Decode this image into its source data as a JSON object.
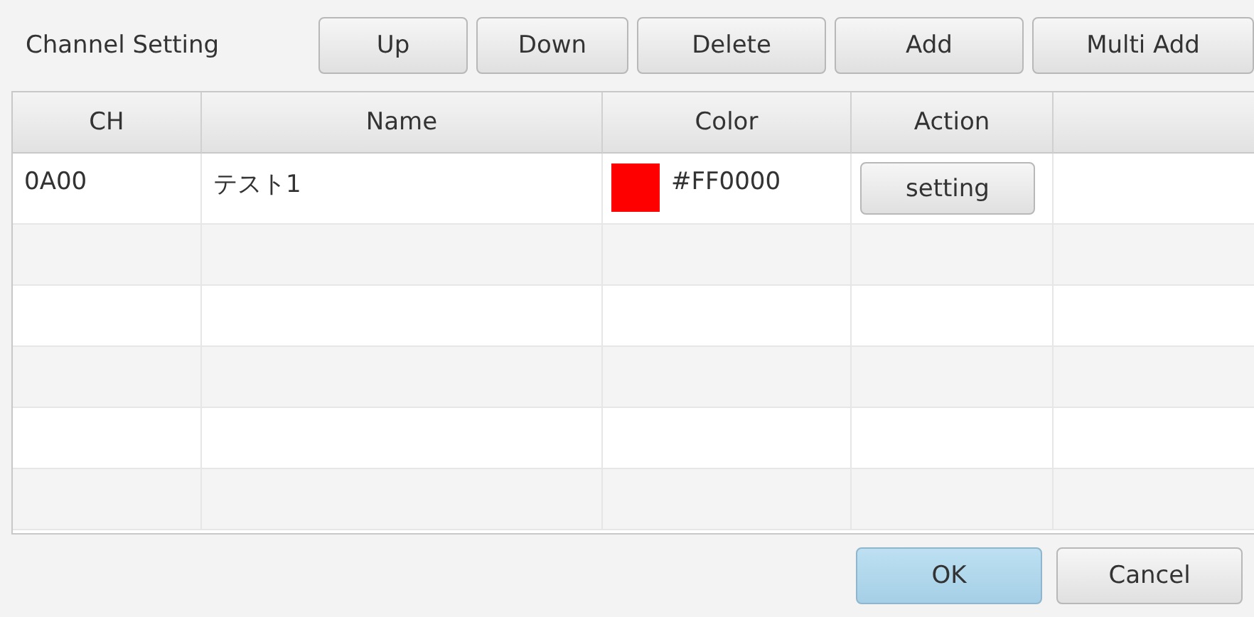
{
  "title": "Channel Setting",
  "toolbar_buttons": [
    "Up",
    "Down",
    "Delete",
    "Add",
    "Multi Add"
  ],
  "table": {
    "columns": [
      "CH",
      "Name",
      "Color",
      "Action"
    ],
    "rows": [
      {
        "ch": "0A00",
        "name": "テスト1",
        "color": "#ff0000",
        "color_text": "#FF0000",
        "action": "setting"
      }
    ]
  },
  "footer_buttons": [
    {
      "label": "OK",
      "kind": "default"
    },
    {
      "label": "Cancel",
      "kind": "normal"
    }
  ]
}
